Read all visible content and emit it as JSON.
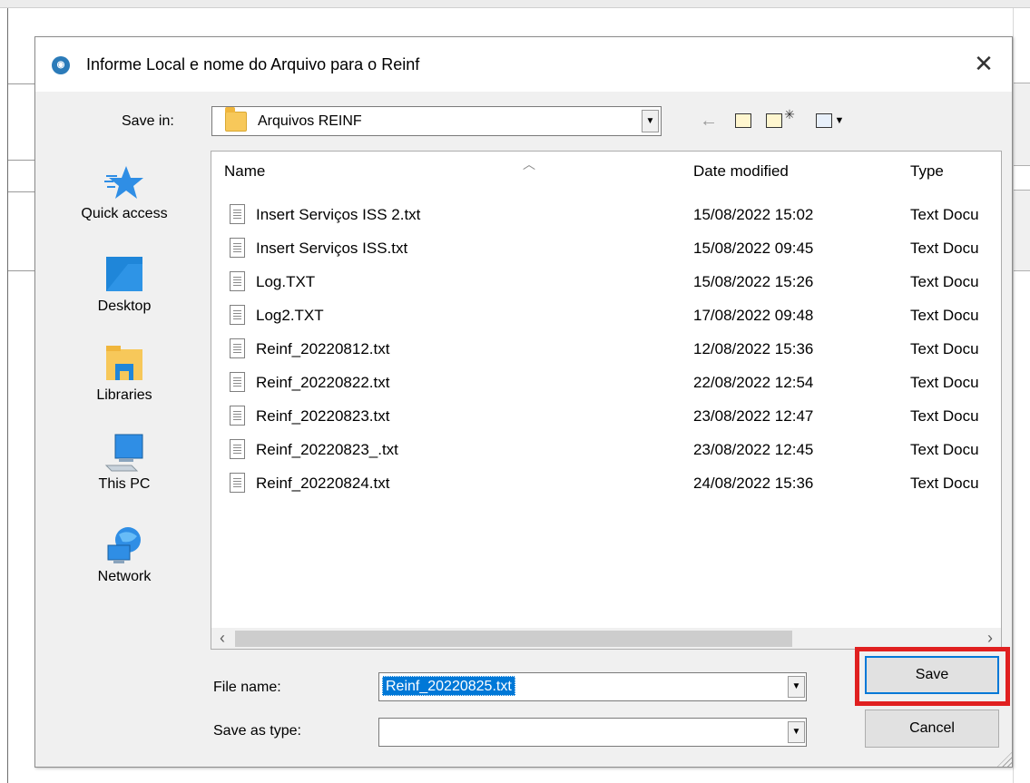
{
  "dialog": {
    "title": "Informe Local e nome do Arquivo para o Reinf",
    "icon": "app-icon",
    "close_glyph": "✕"
  },
  "toolbar": {
    "save_in_label": "Save in:",
    "save_in_value": "Arquivos REINF",
    "icons": [
      "back-arrow-icon",
      "up-folder-icon",
      "new-folder-icon",
      "view-menu-icon"
    ]
  },
  "places": [
    {
      "label": "Quick access",
      "icon": "star-icon"
    },
    {
      "label": "Desktop",
      "icon": "desktop-icon"
    },
    {
      "label": "Libraries",
      "icon": "libraries-icon"
    },
    {
      "label": "This PC",
      "icon": "computer-icon"
    },
    {
      "label": "Network",
      "icon": "network-icon"
    }
  ],
  "columns": {
    "name": "Name",
    "date": "Date modified",
    "type": "Type"
  },
  "files": [
    {
      "name": "Insert Serviços ISS 2.txt",
      "date": "15/08/2022 15:02",
      "type": "Text Docu"
    },
    {
      "name": "Insert Serviços ISS.txt",
      "date": "15/08/2022 09:45",
      "type": "Text Docu"
    },
    {
      "name": "Log.TXT",
      "date": "15/08/2022 15:26",
      "type": "Text Docu"
    },
    {
      "name": "Log2.TXT",
      "date": "17/08/2022 09:48",
      "type": "Text Docu"
    },
    {
      "name": "Reinf_20220812.txt",
      "date": "12/08/2022 15:36",
      "type": "Text Docu"
    },
    {
      "name": "Reinf_20220822.txt",
      "date": "22/08/2022 12:54",
      "type": "Text Docu"
    },
    {
      "name": "Reinf_20220823.txt",
      "date": "23/08/2022 12:47",
      "type": "Text Docu"
    },
    {
      "name": "Reinf_20220823_.txt",
      "date": "23/08/2022 12:45",
      "type": "Text Docu"
    },
    {
      "name": "Reinf_20220824.txt",
      "date": "24/08/2022 15:36",
      "type": "Text Docu"
    }
  ],
  "form": {
    "file_name_label": "File name:",
    "file_name_value": "Reinf_20220825.txt",
    "save_as_type_label": "Save as type:",
    "save_as_type_value": ""
  },
  "buttons": {
    "save": "Save",
    "cancel": "Cancel"
  },
  "colors": {
    "selection": "#0078d7",
    "highlight_box": "#e02020",
    "dialog_bg": "#f0f0f0"
  }
}
